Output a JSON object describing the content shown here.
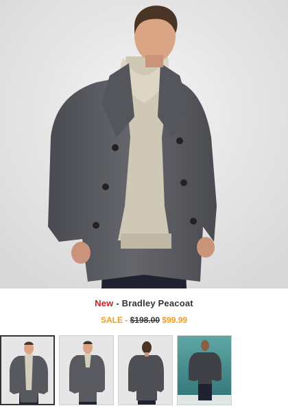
{
  "product": {
    "new_label": "New",
    "separator": " - ",
    "name": "Bradley Peacoat"
  },
  "pricing": {
    "sale_label": "SALE",
    "separator": " - ",
    "original_price": "$198.00",
    "sale_price": "$99.99"
  },
  "thumbnails": [
    {
      "view": "front",
      "selected": true
    },
    {
      "view": "front-alt",
      "selected": false
    },
    {
      "view": "back",
      "selected": false
    },
    {
      "view": "lifestyle",
      "selected": false
    }
  ],
  "colors": {
    "new_red": "#d32020",
    "sale_orange": "#f39a1e",
    "coat_gray": "#5a5b60"
  }
}
